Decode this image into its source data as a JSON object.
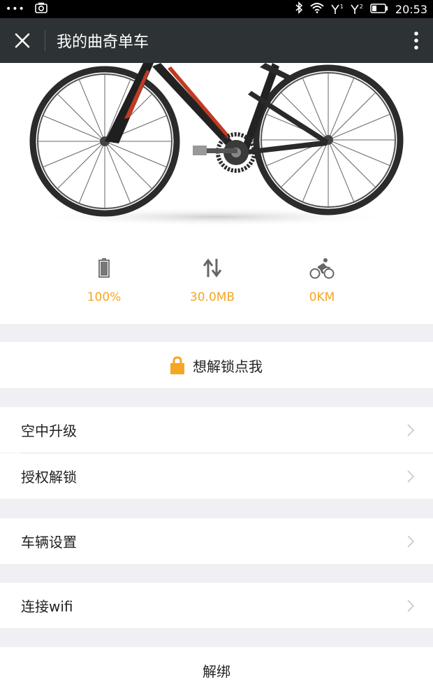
{
  "status_bar": {
    "dots": "•••",
    "time": "20:53",
    "sim1": "1",
    "sim2": "2"
  },
  "header": {
    "title": "我的曲奇单车",
    "close_icon": "close-icon",
    "more_icon": "more-vertical-icon"
  },
  "stats": [
    {
      "icon": "battery-icon",
      "value": "100%",
      "battery_level": 1.0
    },
    {
      "icon": "data-transfer-icon",
      "value": "30.0MB"
    },
    {
      "icon": "cyclist-icon",
      "value": "0KM"
    }
  ],
  "unlock": {
    "label": "想解锁点我",
    "icon": "lock-icon"
  },
  "menu": {
    "ota": "空中升级",
    "auth_unlock": "授权解锁",
    "vehicle_settings": "车辆设置",
    "connect_wifi": "连接wifi"
  },
  "unbind": {
    "label": "解绑"
  },
  "colors": {
    "accent": "#f5a623",
    "titlebar": "#2d3235",
    "background": "#efeff4"
  }
}
